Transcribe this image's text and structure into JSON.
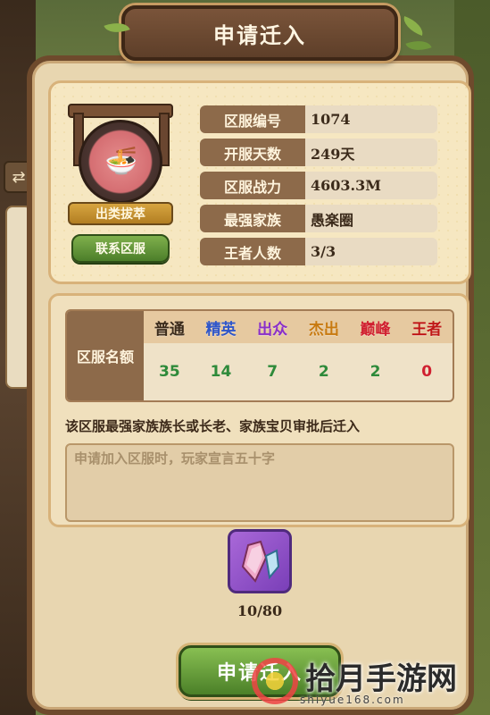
{
  "dialog": {
    "title": "申请迁入"
  },
  "server": {
    "rank_badge": "出类拔萃",
    "contact_button": "联系区服",
    "fields": [
      {
        "label": "区服编号",
        "value": "1074"
      },
      {
        "label": "开服天数",
        "value": "249天"
      },
      {
        "label": "区服战力",
        "value": "4603.3M"
      },
      {
        "label": "最强家族",
        "value": "愚楽圈"
      },
      {
        "label": "王者人数",
        "value": "3/3"
      }
    ]
  },
  "quota": {
    "header": "区服名额",
    "tiers": [
      {
        "name": "普通",
        "color": "#3a2a1a",
        "count": "35"
      },
      {
        "name": "精英",
        "color": "#2f56c9",
        "count": "14"
      },
      {
        "name": "出众",
        "color": "#8a2fc9",
        "count": "7"
      },
      {
        "name": "杰出",
        "color": "#c87a10",
        "count": "2"
      },
      {
        "name": "巅峰",
        "color": "#d02030",
        "count": "2"
      },
      {
        "name": "王者",
        "color": "#c01818",
        "count": "0"
      }
    ],
    "count_colors": [
      "#2e8a3a",
      "#2e8a3a",
      "#2e8a3a",
      "#2e8a3a",
      "#2e8a3a",
      "#d02030"
    ]
  },
  "rule_text": "该区服最强家族族长或长老、家族宝贝审批后迁入",
  "declaration_placeholder": "申请加入区服时，玩家宣言五十字",
  "cost": {
    "icon": "crystal-icon",
    "amount": "10/80"
  },
  "submit_button": "申请迁入",
  "watermark": {
    "text": "拾月手游网",
    "url": "shiyue168.com"
  }
}
